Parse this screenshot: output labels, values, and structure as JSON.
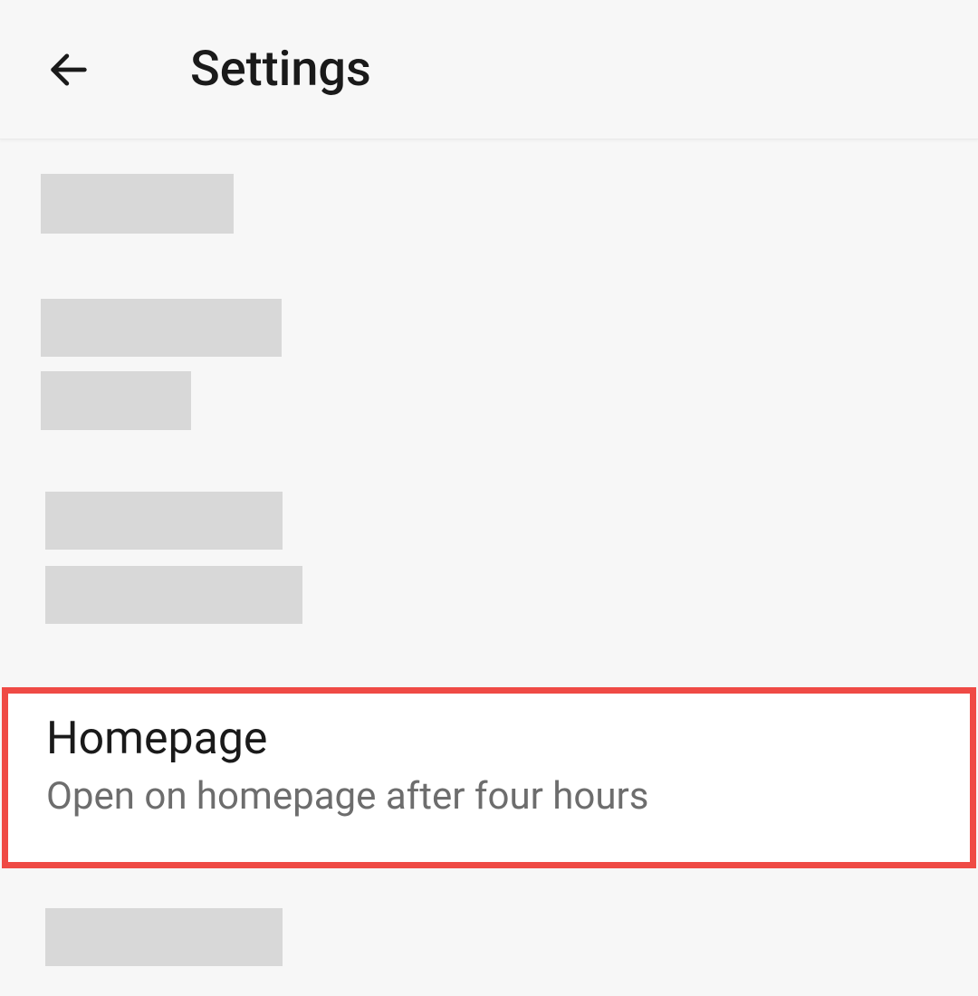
{
  "header": {
    "title": "Settings"
  },
  "homepage_item": {
    "title": "Homepage",
    "subtitle": "Open on homepage after four hours"
  }
}
